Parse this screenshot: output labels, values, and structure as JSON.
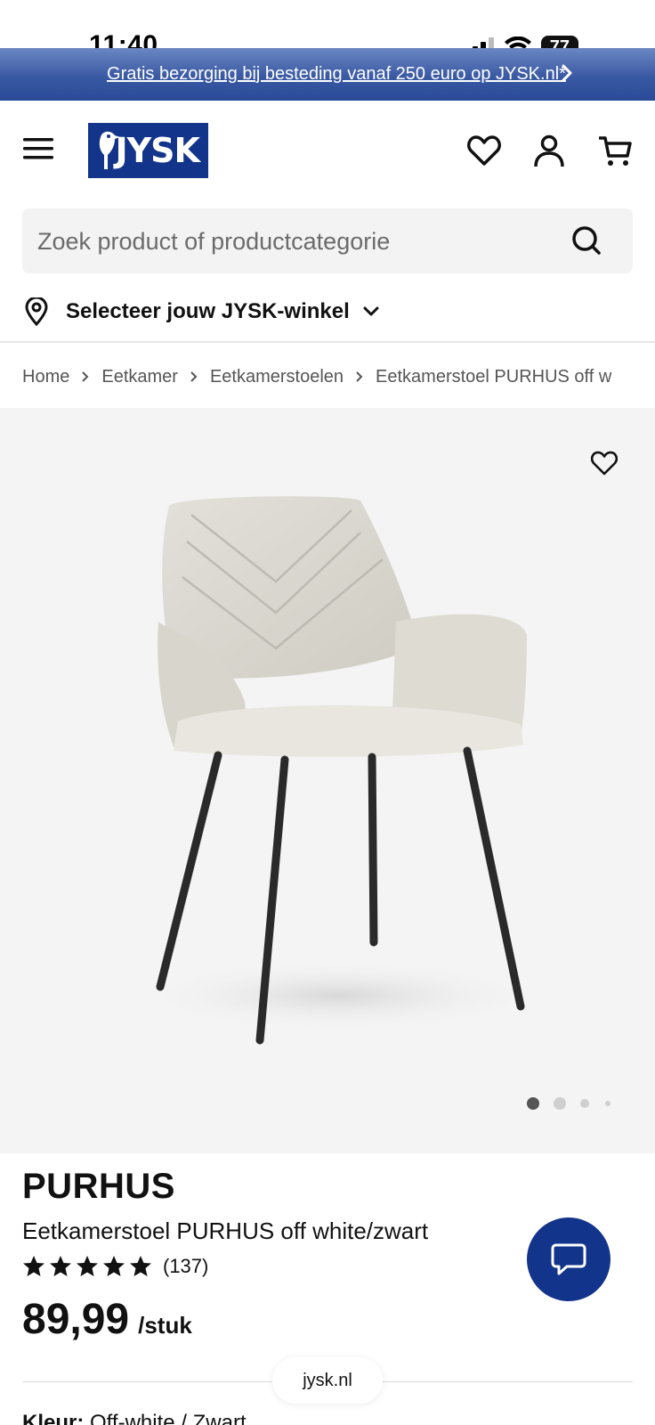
{
  "status_bar": {
    "time": "11:40",
    "battery": "77"
  },
  "promo_banner": {
    "text": "Gratis bezorging bij besteding vanaf 250 euro op JYSK.nl*"
  },
  "header": {
    "logo_text": "JYSK",
    "brand_color": "#13348b"
  },
  "search": {
    "placeholder": "Zoek product of productcategorie"
  },
  "store_selector": {
    "label": "Selecteer jouw JYSK-winkel"
  },
  "breadcrumb": [
    "Home",
    "Eetkamer",
    "Eetkamerstoelen",
    "Eetkamerstoel PURHUS off w"
  ],
  "gallery": {
    "image_count": 4,
    "active_index": 0
  },
  "product": {
    "brand": "PURHUS",
    "name": "Eetkamerstoel PURHUS off white/zwart",
    "rating_stars": 5,
    "review_count": "(137)",
    "price": "89,99",
    "price_unit": "/stuk",
    "color_label": "Kleur:",
    "color_value": "Off-white / Zwart"
  },
  "browser": {
    "url": "jysk.nl"
  }
}
